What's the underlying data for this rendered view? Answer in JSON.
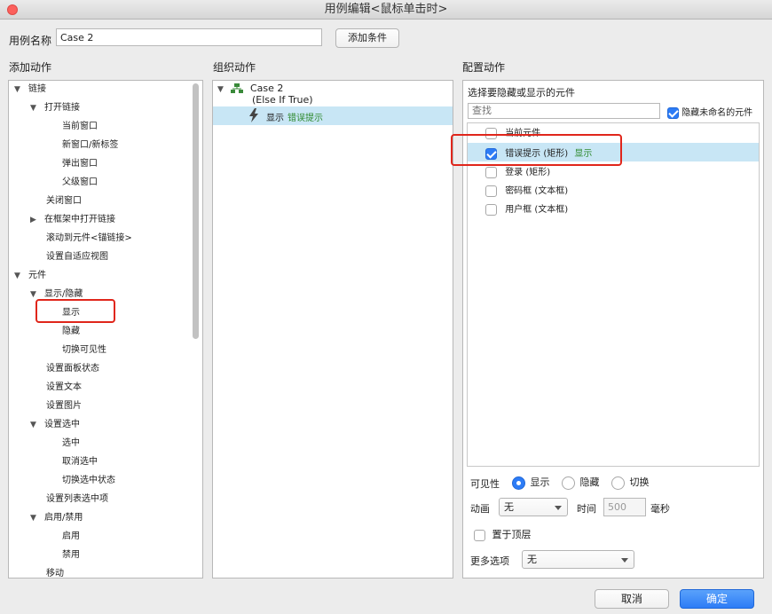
{
  "window": {
    "title": "用例编辑<鼠标单击时>"
  },
  "case_name": {
    "label": "用例名称",
    "value": "Case 2",
    "add_condition": "添加条件"
  },
  "sections": {
    "add_action": "添加动作",
    "organize_action": "组织动作",
    "configure_action": "配置动作"
  },
  "actions_tree": [
    {
      "label": "链接",
      "expanded": true
    },
    {
      "label": "打开链接",
      "expanded": true
    },
    {
      "label": "当前窗口"
    },
    {
      "label": "新窗口/新标签"
    },
    {
      "label": "弹出窗口"
    },
    {
      "label": "父级窗口"
    },
    {
      "label": "关闭窗口"
    },
    {
      "label": "在框架中打开链接",
      "expanded": false
    },
    {
      "label": "滚动到元件<锚链接>"
    },
    {
      "label": "设置自适应视图"
    },
    {
      "label": "元件",
      "expanded": true
    },
    {
      "label": "显示/隐藏",
      "expanded": true
    },
    {
      "label": "显示"
    },
    {
      "label": "隐藏"
    },
    {
      "label": "切换可见性"
    },
    {
      "label": "设置面板状态"
    },
    {
      "label": "设置文本"
    },
    {
      "label": "设置图片"
    },
    {
      "label": "设置选中",
      "expanded": true
    },
    {
      "label": "选中"
    },
    {
      "label": "取消选中"
    },
    {
      "label": "切换选中状态"
    },
    {
      "label": "设置列表选中项"
    },
    {
      "label": "启用/禁用",
      "expanded": true
    },
    {
      "label": "启用"
    },
    {
      "label": "禁用"
    },
    {
      "label": "移动"
    }
  ],
  "organize": {
    "case_title": "Case 2",
    "case_condition": "(Else If True)",
    "action_verb": "显示",
    "action_target": "错误提示"
  },
  "configure": {
    "prompt": "选择要隐藏或显示的元件",
    "search_placeholder": "查找",
    "hide_unnamed_label": "隐藏未命名的元件",
    "hide_unnamed_checked": true,
    "widgets": [
      {
        "label": "当前元件",
        "checked": false,
        "status": ""
      },
      {
        "label": "错误提示 (矩形)",
        "checked": true,
        "status": "显示"
      },
      {
        "label": "登录 (矩形)",
        "checked": false,
        "status": ""
      },
      {
        "label": "密码框 (文本框)",
        "checked": false,
        "status": ""
      },
      {
        "label": "用户框 (文本框)",
        "checked": false,
        "status": ""
      }
    ],
    "visibility": {
      "label": "可见性",
      "options": [
        "显示",
        "隐藏",
        "切换"
      ],
      "selected": "显示"
    },
    "animation": {
      "label": "动画",
      "value": "无",
      "time_label": "时间",
      "time_value": "500",
      "unit": "毫秒"
    },
    "bring_to_front": {
      "label": "置于顶层",
      "checked": false
    },
    "more_options": {
      "label": "更多选项",
      "value": "无"
    }
  },
  "footer": {
    "cancel": "取消",
    "ok": "确定"
  },
  "colors": {
    "accent": "#2d7cf6",
    "highlight": "#c8e6f5",
    "status_green": "#2f8a2f",
    "annotation_red": "#e0261b"
  }
}
